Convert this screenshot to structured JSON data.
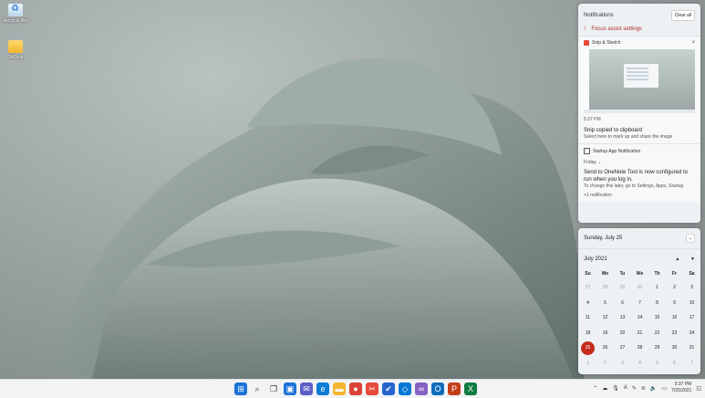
{
  "desktop": {
    "icons": [
      {
        "label": "Recycle Bin",
        "icon": "recycle-bin-icon"
      },
      {
        "label": "TikStop",
        "icon": "folder-icon"
      }
    ]
  },
  "notifications": {
    "title": "Notifications",
    "clear_all": "Clear all",
    "focus_assist": "Focus assist settings",
    "snip": {
      "app": "Snip & Sketch",
      "time": "5:37 PM",
      "message": "Snip copied to clipboard",
      "sub": "Select here to mark up and share the image"
    },
    "startup": {
      "app": "Startup App Notification",
      "day": "Friday",
      "message": "Send to OneNote Tool is now configured to run when you log in.",
      "sub": "To change this later, go to Settings, Apps, Startup",
      "more": "+1 notification"
    }
  },
  "calendar": {
    "date_header": "Sunday, July 25",
    "month": "July 2021",
    "weekdays": [
      "Su",
      "Mo",
      "Tu",
      "We",
      "Th",
      "Fr",
      "Sa"
    ],
    "days": [
      [
        "27",
        "28",
        "29",
        "30",
        "1",
        "2",
        "3"
      ],
      [
        "4",
        "5",
        "6",
        "7",
        "8",
        "9",
        "10"
      ],
      [
        "11",
        "12",
        "13",
        "14",
        "15",
        "16",
        "17"
      ],
      [
        "18",
        "19",
        "20",
        "21",
        "22",
        "23",
        "24"
      ],
      [
        "25",
        "26",
        "27",
        "28",
        "29",
        "30",
        "31"
      ],
      [
        "1",
        "2",
        "3",
        "4",
        "5",
        "6",
        "7"
      ]
    ],
    "today": "25"
  },
  "taskbar": {
    "time": "5:37 PM",
    "date": "7/25/2021",
    "apps": [
      "start-icon",
      "search-icon",
      "task-view-icon",
      "widgets-icon",
      "chat-icon",
      "edge-icon",
      "file-explorer-icon",
      "chrome-icon",
      "snip-icon",
      "todo-icon",
      "vscode-icon",
      "visual-studio-icon",
      "outlook-icon",
      "powerpoint-icon",
      "excel-icon"
    ]
  },
  "colors": {
    "accent": "#c42b1c",
    "panel": "#eef1f3"
  }
}
